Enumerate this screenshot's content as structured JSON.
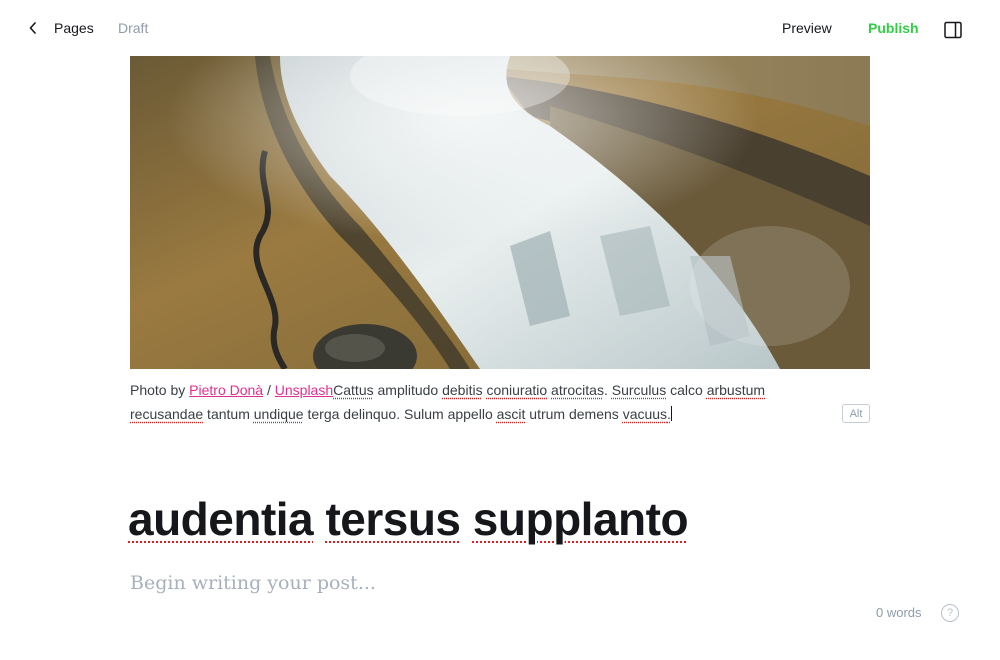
{
  "header": {
    "back_label": "Pages",
    "status": "Draft",
    "preview_label": "Preview",
    "publish_label": "Publish",
    "accent_color": "#30cf43"
  },
  "feature_image": {
    "icon": "waterfall-photo"
  },
  "caption": {
    "prefix": "Photo by ",
    "author_link": "Pietro Donà",
    "separator": " / ",
    "source_link": "Unsplash",
    "words": [
      "Cattus",
      " amplitudo ",
      "debitis",
      " ",
      "coniuratio",
      " ",
      "atrocitas",
      ". ",
      "Surculus",
      " calco ",
      "arbustum",
      " ",
      "recusandae",
      " tantum ",
      "undique",
      " terga delinquo. Sulum appello ",
      "ascit",
      " utrum demens ",
      "vacuus",
      "."
    ],
    "link_color": "#e0308f"
  },
  "alt_button": {
    "label": "Alt"
  },
  "post": {
    "title_words": [
      "audentia",
      " ",
      "tersus",
      " ",
      "supplanto"
    ],
    "body_placeholder": "Begin writing your post..."
  },
  "footer": {
    "word_count": "0 words",
    "help_label": "?"
  }
}
